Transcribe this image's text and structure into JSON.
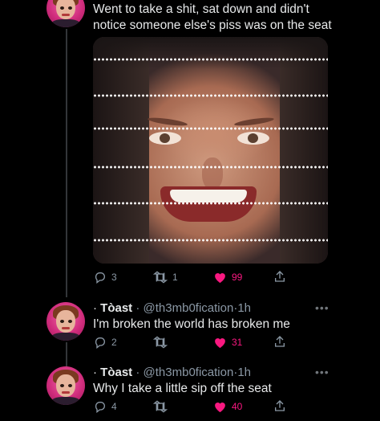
{
  "tweets": [
    {
      "text_lines": [
        "Went to take a shit, sat down and didn't",
        "notice someone else's piss was on the seat"
      ],
      "replies": "3",
      "retweets": "1",
      "likes": "99"
    },
    {
      "lead": "·",
      "name": "Tòast",
      "dot1": "·",
      "handle": "@th3mb0fication",
      "dot2": "·",
      "time": "1h",
      "text": "I'm broken the world has broken me",
      "replies": "2",
      "retweets": "",
      "likes": "31"
    },
    {
      "lead": "·",
      "name": "Tòast",
      "dot1": "·",
      "handle": "@th3mb0fication",
      "dot2": "·",
      "time": "1h",
      "text": "Why I take a little sip off the seat",
      "replies": "4",
      "retweets": "",
      "likes": "40"
    }
  ],
  "more_label": "•••",
  "colors": {
    "like": "#f91880",
    "muted": "#8b98a5",
    "text": "#e7e9ea"
  },
  "icons": [
    "reply-icon",
    "retweet-icon",
    "heart-icon",
    "share-icon",
    "more-icon"
  ]
}
